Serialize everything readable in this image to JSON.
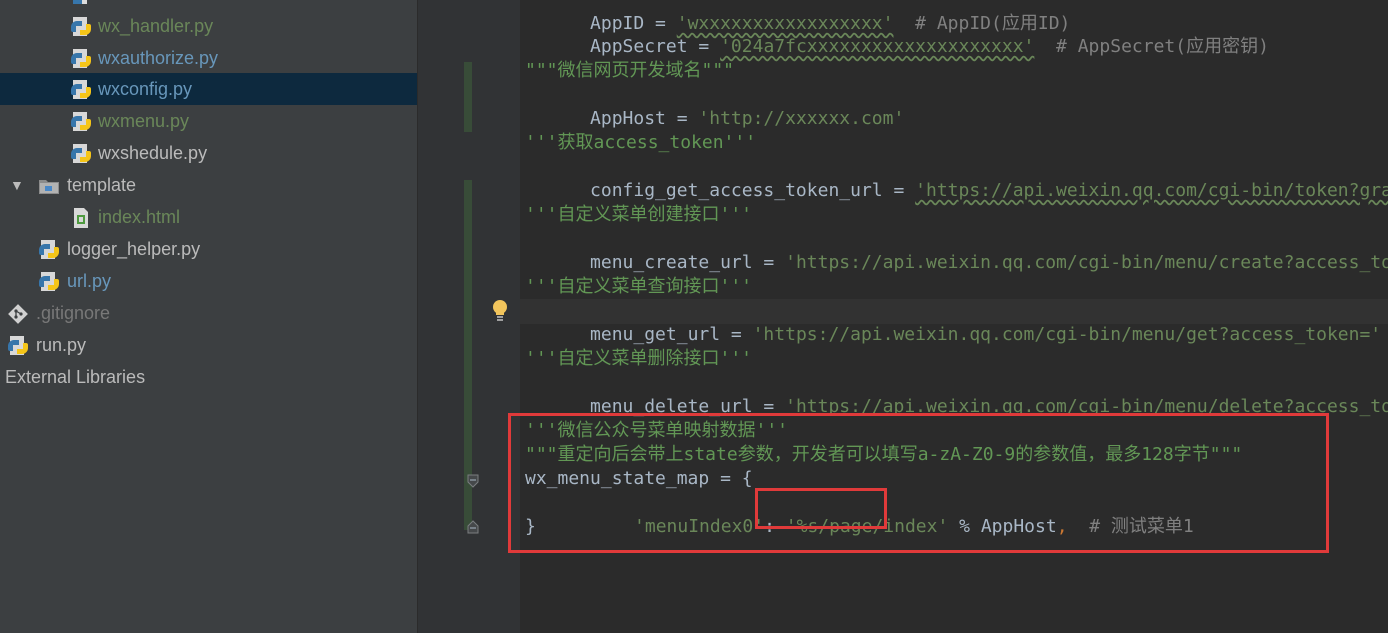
{
  "project_tree": {
    "items": [
      {
        "label": "wx_handler.py",
        "type": "python",
        "color": "#6a8759",
        "selected": false
      },
      {
        "label": "wxauthorize.py",
        "type": "python",
        "color": "#6897bb",
        "selected": false
      },
      {
        "label": "wxconfig.py",
        "type": "python",
        "color": "#6897bb",
        "selected": true
      },
      {
        "label": "wxmenu.py",
        "type": "python",
        "color": "#6a8759",
        "selected": false
      },
      {
        "label": "wxshedule.py",
        "type": "python",
        "color": "#bbbbbb",
        "selected": false
      },
      {
        "label": "template",
        "type": "folder",
        "color": "#bbbbbb",
        "selected": false,
        "expanded": true
      },
      {
        "label": "index.html",
        "type": "html",
        "color": "#6a8759",
        "selected": false
      },
      {
        "label": "logger_helper.py",
        "type": "python",
        "color": "#bbbbbb",
        "selected": false
      },
      {
        "label": "url.py",
        "type": "python",
        "color": "#6897bb",
        "selected": false
      },
      {
        "label": ".gitignore",
        "type": "git",
        "color": "#787878",
        "selected": false
      },
      {
        "label": "run.py",
        "type": "python",
        "color": "#bbbbbb",
        "selected": false
      },
      {
        "label": "External Libraries",
        "type": "library",
        "color": "#bbbbbb",
        "selected": false
      }
    ]
  },
  "editor": {
    "lines": {
      "appid": {
        "name": "AppID",
        "op": " = ",
        "value": "'wxxxxxxxxxxxxxxxxx'",
        "comment": "  # AppID(应用ID)"
      },
      "appsecret": {
        "name": "AppSecret",
        "op": " = ",
        "value": "'024a7fcxxxxxxxxxxxxxxxxxxxx'",
        "comment": "  # AppSecret(应用密钥)"
      },
      "host_doc": "\"\"\"微信网页开发域名\"\"\"",
      "apphost": {
        "name": "AppHost",
        "op": " = ",
        "value": "'http://xxxxxx.com'"
      },
      "token_doc": "'''获取access_token'''",
      "token_url": {
        "name": "config_get_access_token_url",
        "op": " = ",
        "value": "'https://api.weixin.qq.com/cgi-bin/token?grant_type=client_credential&appid='"
      },
      "create_doc": "'''自定义菜单创建接口'''",
      "create_url": {
        "name": "menu_create_url",
        "op": " = ",
        "value": "'https://api.weixin.qq.com/cgi-bin/menu/create?access_token='"
      },
      "get_doc": "'''自定义菜单查询接口'''",
      "get_url": {
        "name": "menu_get_url",
        "op": " = ",
        "value": "'https://api.weixin.qq.com/cgi-bin/menu/get?access_token='"
      },
      "delete_doc": "'''自定义菜单删除接口'''",
      "delete_url": {
        "name": "menu_delete_url",
        "op": " = ",
        "value": "'https://api.weixin.qq.com/cgi-bin/menu/delete?access_token='"
      },
      "map_doc1": "'''微信公众号菜单映射数据'''",
      "map_doc2": "\"\"\"重定向后会带上state参数，开发者可以填写a-zA-Z0-9的参数值，最多128字节\"\"\"",
      "map_open": "wx_menu_state_map = {",
      "map_entry": {
        "key": "'menuIndex0'",
        "colon": ": ",
        "value": "'%s/page/index'",
        "op": " % AppHost",
        "comma": ",",
        "comment": "  # 测试菜单1"
      },
      "map_close": "}"
    }
  },
  "colors": {
    "string": "#6a8759",
    "docstring": "#629755",
    "comment": "#808080",
    "keyword": "#cc7832",
    "identifier": "#a9b7c6",
    "highlight": "#e03a3a",
    "selection": "#0d293e"
  },
  "icons": {
    "bulb": "lightbulb-icon",
    "python": "python-file-icon",
    "folder": "folder-icon",
    "html": "html-file-icon",
    "git": "git-icon"
  }
}
